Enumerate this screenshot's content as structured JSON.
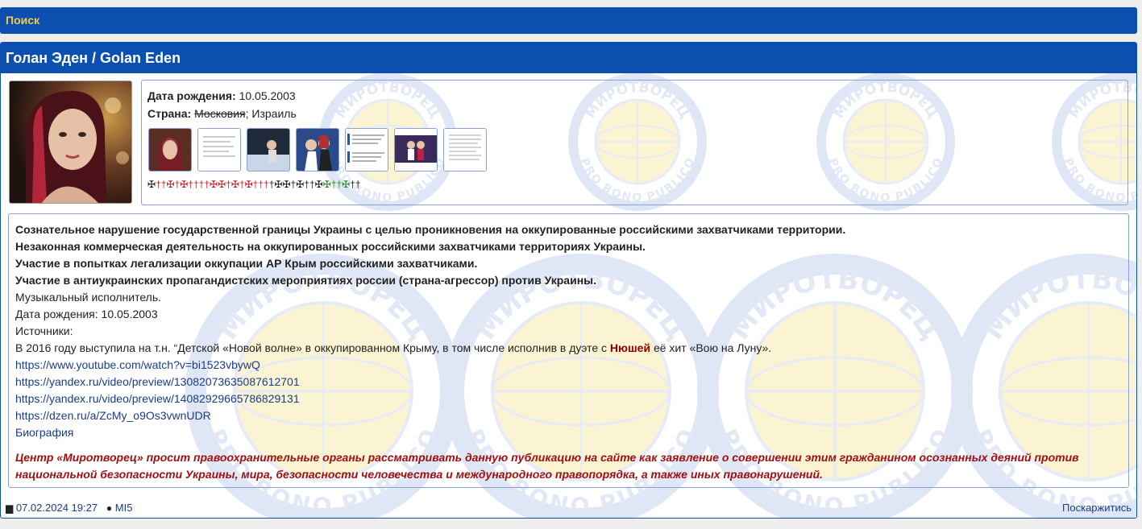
{
  "search": {
    "label": "Поиск"
  },
  "profile": {
    "title": "Голан Эден / Golan Eden",
    "birth_label": "Дата рождения:",
    "birth_value": "10.05.2003",
    "country_label": "Страна:",
    "country_old": "Московия",
    "country_sep": ";",
    "country_value": "Израиль"
  },
  "thumbnails": [
    {
      "name": "thumb-photo-portrait"
    },
    {
      "name": "thumb-document-1"
    },
    {
      "name": "thumb-stage-photo"
    },
    {
      "name": "thumb-duet-photo"
    },
    {
      "name": "thumb-news-screenshot"
    },
    {
      "name": "thumb-stage-photo-2"
    },
    {
      "name": "thumb-document-2"
    }
  ],
  "colors": {
    "header": "#0d4fae",
    "search_text": "#f0d040",
    "warning": "#a01010",
    "link": "#1a3c8a"
  },
  "description": {
    "bold_lines": [
      "Сознательное нарушение государственной границы Украины с целью проникновения на оккупированные российскими захватчиками территории.",
      "Незаконная коммерческая деятельность на оккупированных российскими захватчиками территориях Украины.",
      "Участие в попытках легализации оккупации АР Крым российскими захватчиками.",
      "Участие в антиукраинских пропагандистских мероприятиях россии (страна-агрессор) против Украины."
    ],
    "occupation": "Музыкальный исполнитель.",
    "birth_line": "Дата рождения: 10.05.2003",
    "sources_label": "Источники:",
    "story_before": "В 2016 году выступила на т.н. “Детской «Новой волне» в оккупированном Крыму, в том числе исполнив в дуэте с ",
    "story_name": "Нюшей",
    "story_after": " её хит «Вою на Луну».",
    "links": [
      "https://www.youtube.com/watch?v=bi1523vbywQ",
      "https://yandex.ru/video/preview/13082073635087612701",
      "https://yandex.ru/video/preview/14082929665786829131",
      "https://dzen.ru/a/ZcMy_o9Os3vwnUDR"
    ],
    "bio_link": "Биография",
    "warning": "Центр «Миротворец» просит правоохранительные органы рассматривать данную публикацию на сайте как заявление о совершении этим гражданином осознанных деяний против национальной безопасности Украины, мира, безопасности человечества и международного правопорядка, а также иных правонарушений."
  },
  "footer": {
    "date": "07.02.2024 19:27",
    "author": "MI5",
    "complain": "Поскаржитись"
  },
  "watermark": {
    "top_text": "МИРОТВОРЕЦ",
    "bottom_text": "PRO BONO PUBLICO"
  },
  "icons": {
    "date": "calendar-icon",
    "author": "user-icon",
    "crosses": "cross-marks"
  }
}
